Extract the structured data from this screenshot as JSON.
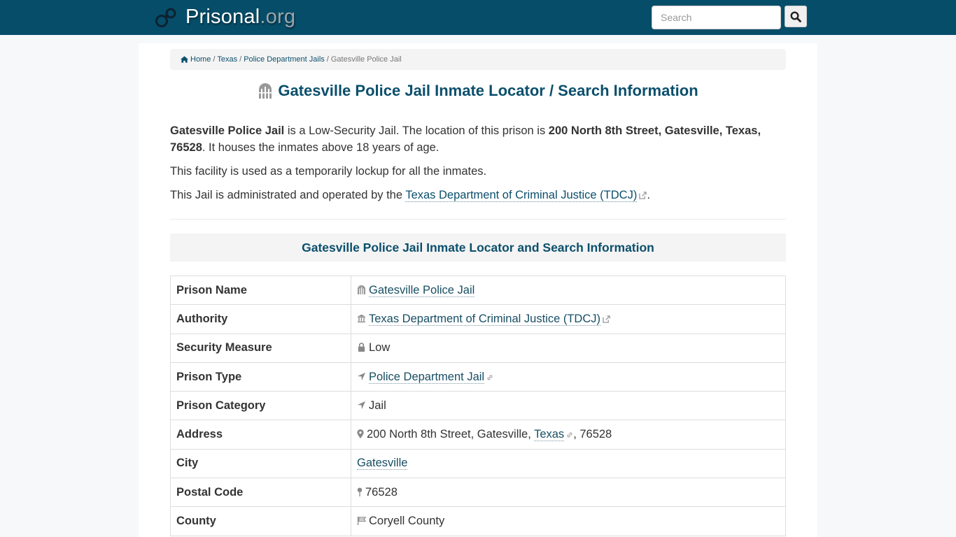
{
  "header": {
    "logo_main": "Prisonal",
    "logo_tld": ".org",
    "search_placeholder": "Search",
    "search_value": ""
  },
  "breadcrumb": {
    "items": [
      {
        "label": "Home",
        "icon": "home-icon"
      },
      {
        "label": "Texas"
      },
      {
        "label": "Police Department Jails"
      },
      {
        "label": "Gatesville Police Jail",
        "current": true
      }
    ],
    "separator": "/"
  },
  "title": "Gatesville Police Jail Inmate Locator / Search Information",
  "intro": {
    "p1_name": "Gatesville Police Jail",
    "p1_mid": " is a Low-Security Jail. The location of this prison is ",
    "p1_address": "200 North 8th Street, Gatesville, Texas, 76528",
    "p1_end": ". It houses the inmates above 18 years of age.",
    "p2": "This facility is used as a temporarily lockup for all the inmates.",
    "p3_start": "This Jail is administrated and operated by the ",
    "p3_link": "Texas Department of Criminal Justice (TDCJ)",
    "p3_end": "."
  },
  "section_title": "Gatesville Police Jail Inmate Locator and Search Information",
  "table": {
    "rows": [
      {
        "label": "Prison Name",
        "value": "Gatesville Police Jail",
        "icon": "prison-gate-icon",
        "link": true
      },
      {
        "label": "Authority",
        "value": "Texas Department of Criminal Justice (TDCJ)",
        "icon": "institution-icon",
        "link": true,
        "external": true
      },
      {
        "label": "Security Measure",
        "value": "Low",
        "icon": "lock-icon"
      },
      {
        "label": "Prison Type",
        "value": "Police Department Jail",
        "icon": "location-arrow-icon",
        "link": true
      },
      {
        "label": "Prison Category",
        "value": "Jail",
        "icon": "location-arrow-icon"
      },
      {
        "label": "Address",
        "value_prefix": "200 North 8th Street, Gatesville, ",
        "value_link": "Texas",
        "value_suffix": ", 76528",
        "icon": "map-marker-icon"
      },
      {
        "label": "City",
        "value": "Gatesville",
        "link": true
      },
      {
        "label": "Postal Code",
        "value": "76528",
        "icon": "map-pin-icon"
      },
      {
        "label": "County",
        "value": "Coryell County",
        "icon": "flag-icon"
      }
    ]
  },
  "colors": {
    "header_bg": "#064d69",
    "accent": "#0b4f6c",
    "page_bg": "#f7f8fa",
    "panel_bg": "#ffffff"
  }
}
